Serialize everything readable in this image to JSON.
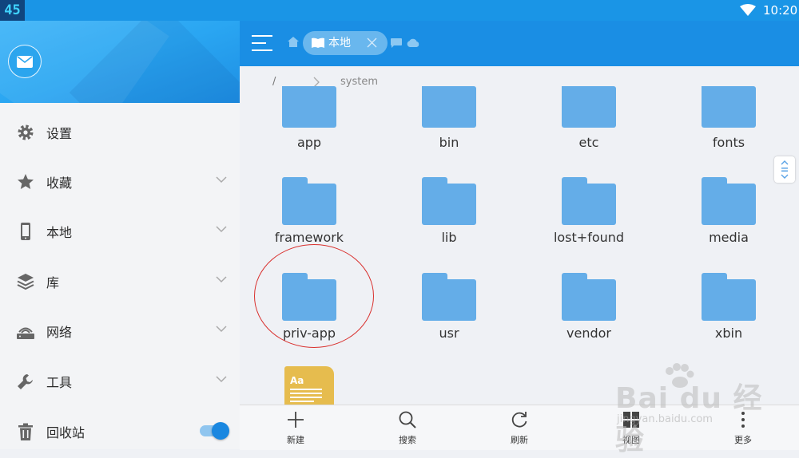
{
  "status_bar": {
    "badge": "45",
    "time": "10:20"
  },
  "drawer": {
    "items": [
      {
        "label": "设置",
        "icon": "gear-icon",
        "expandable": false
      },
      {
        "label": "收藏",
        "icon": "star-icon",
        "expandable": true
      },
      {
        "label": "本地",
        "icon": "phone-icon",
        "expandable": true
      },
      {
        "label": "库",
        "icon": "layers-icon",
        "expandable": true
      },
      {
        "label": "网络",
        "icon": "network-icon",
        "expandable": true
      },
      {
        "label": "工具",
        "icon": "wrench-icon",
        "expandable": true
      },
      {
        "label": "回收站",
        "icon": "trash-icon",
        "toggle_on": true
      }
    ]
  },
  "toolbar": {
    "tab_label": "本地"
  },
  "breadcrumb": {
    "root": "/",
    "current": "system"
  },
  "files": [
    {
      "name": "app",
      "type": "folder"
    },
    {
      "name": "bin",
      "type": "folder"
    },
    {
      "name": "etc",
      "type": "folder"
    },
    {
      "name": "fonts",
      "type": "folder"
    },
    {
      "name": "framework",
      "type": "folder"
    },
    {
      "name": "lib",
      "type": "folder"
    },
    {
      "name": "lost+found",
      "type": "folder"
    },
    {
      "name": "media",
      "type": "folder"
    },
    {
      "name": "priv-app",
      "type": "folder",
      "highlighted": true
    },
    {
      "name": "usr",
      "type": "folder"
    },
    {
      "name": "vendor",
      "type": "folder"
    },
    {
      "name": "xbin",
      "type": "folder"
    },
    {
      "name": "",
      "type": "txt-file",
      "icon_text": "Aa"
    }
  ],
  "bottom_bar": {
    "new": "新建",
    "search": "搜索",
    "refresh": "刷新",
    "view": "视图",
    "more": "更多"
  },
  "watermark": {
    "brand": "Bai du 经验",
    "url": "jingyan.baidu.com"
  },
  "colors": {
    "accent": "#1a8ee4",
    "folder": "#64ade8",
    "highlight_circle": "#d9302d",
    "txt_file": "#e6bc4e"
  }
}
